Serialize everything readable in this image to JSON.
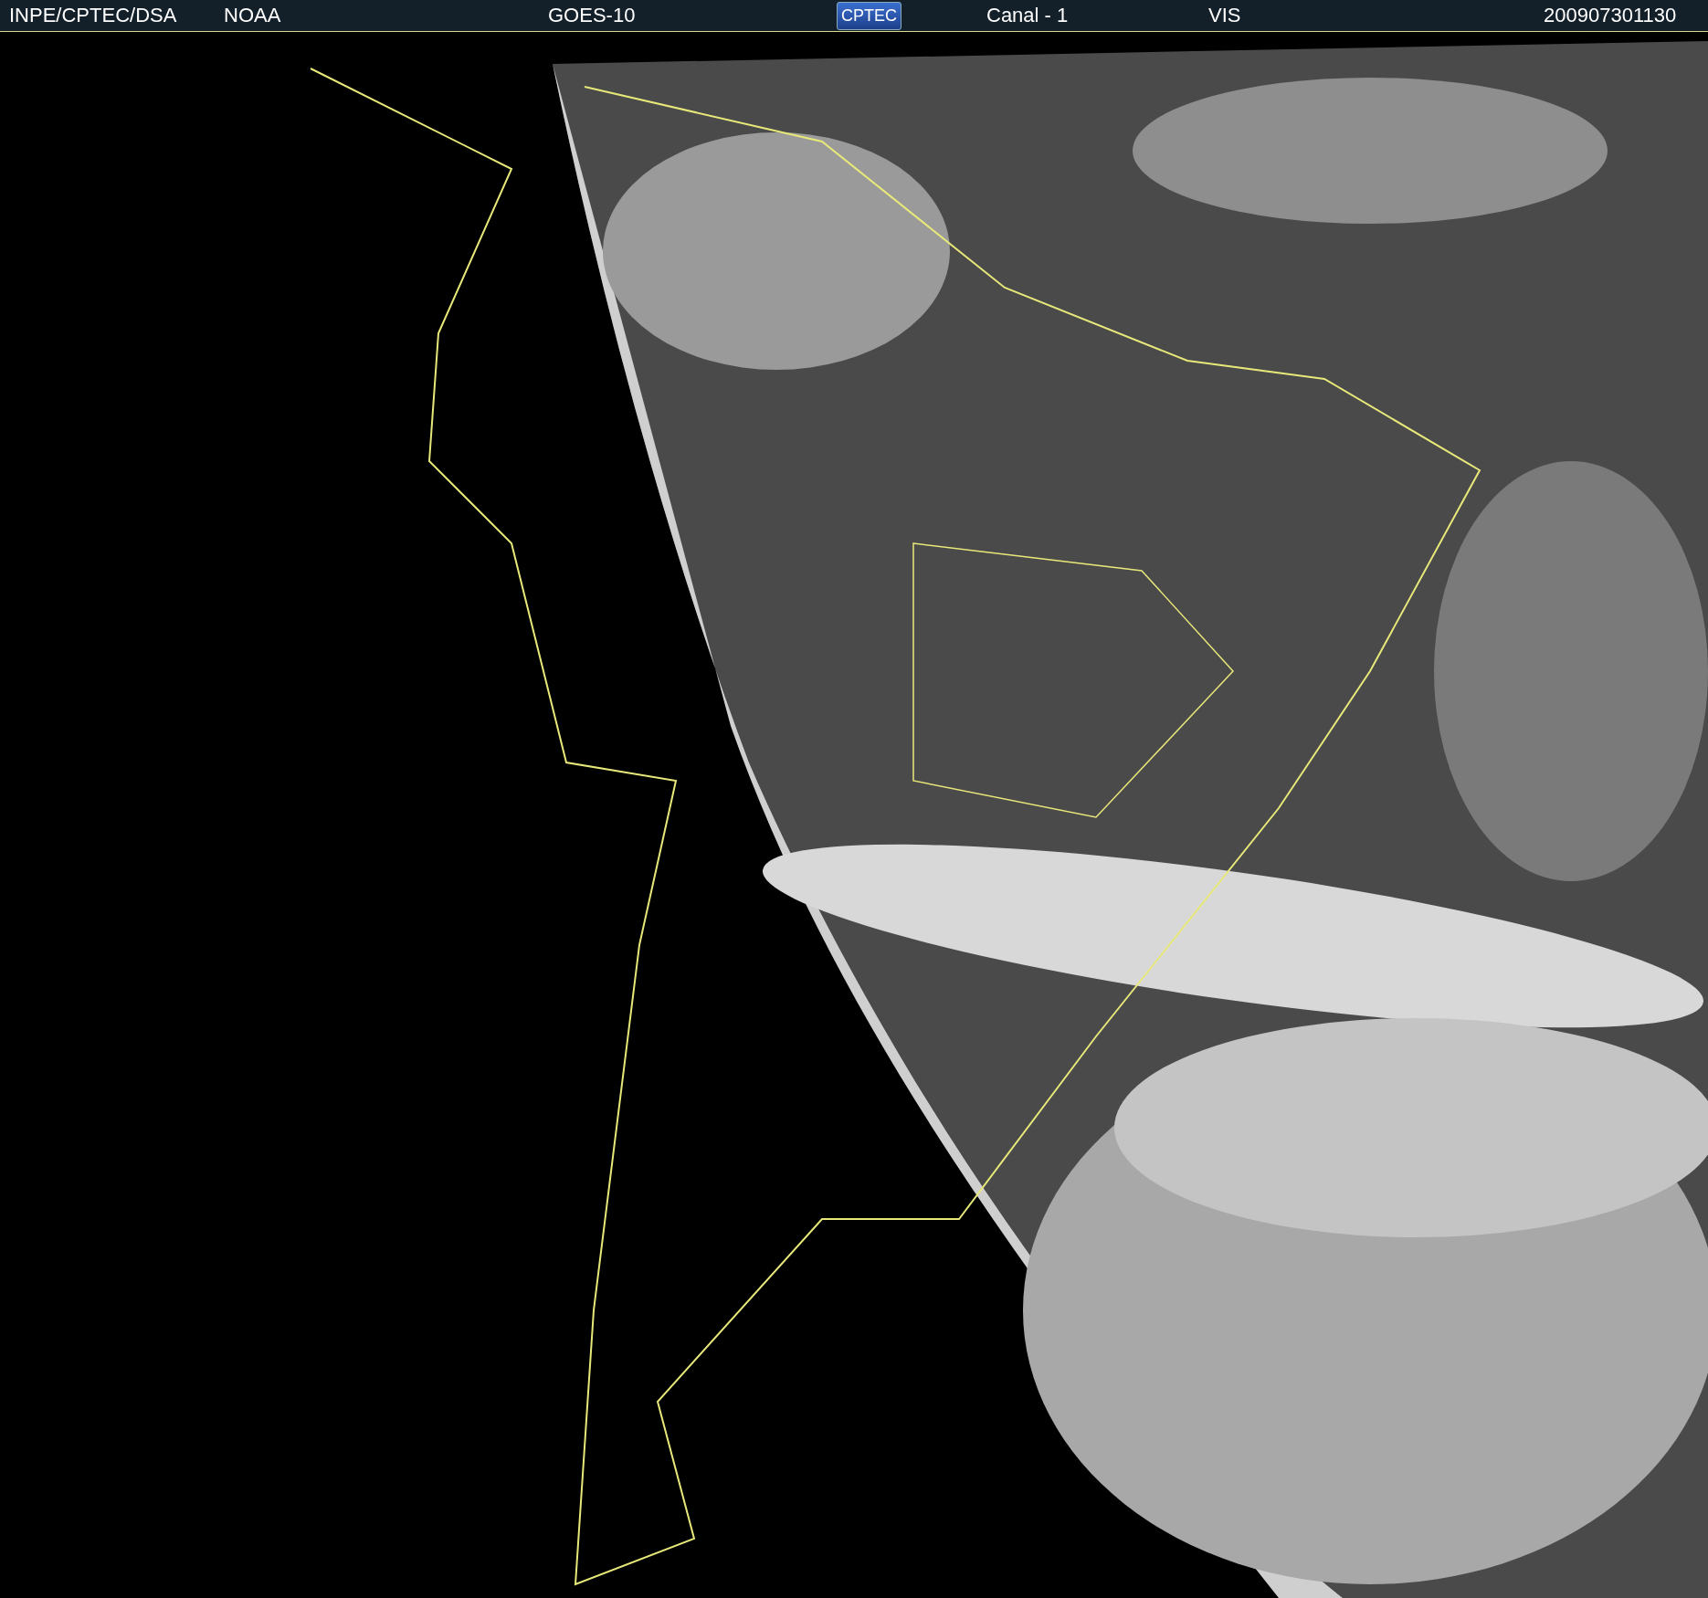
{
  "header": {
    "items": [
      {
        "kind": "text",
        "text": "INPE/CPTEC/DSA"
      },
      {
        "kind": "text",
        "text": "NOAA"
      },
      {
        "kind": "text",
        "text": "GOES-10"
      },
      {
        "kind": "logo",
        "text": "CPTEC"
      },
      {
        "kind": "text",
        "text": "Canal - 1"
      },
      {
        "kind": "text",
        "text": "VIS"
      },
      {
        "kind": "text",
        "text": "200907301130"
      }
    ]
  }
}
